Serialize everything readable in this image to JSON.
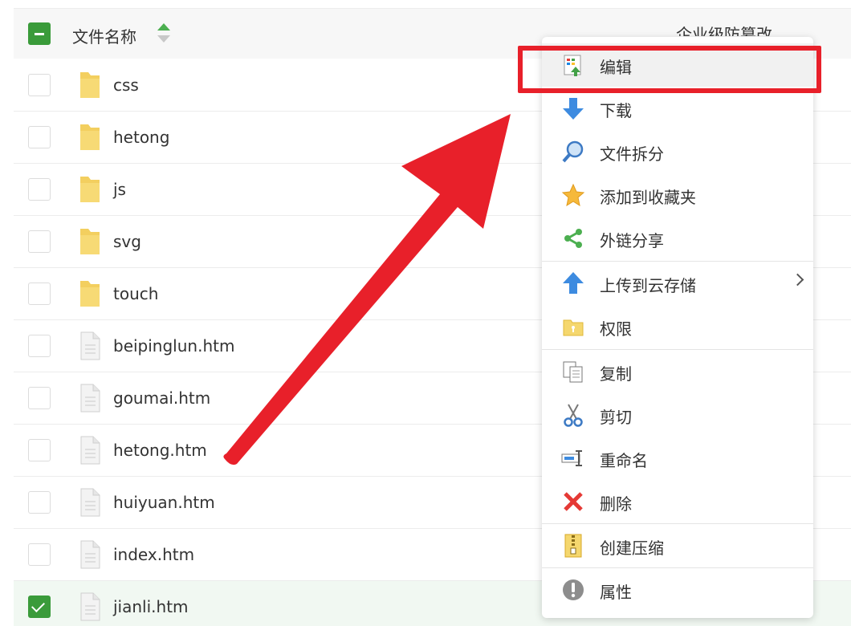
{
  "header": {
    "name_label": "文件名称",
    "col2_label": "企业级防篡改"
  },
  "files": [
    {
      "name": "css",
      "type": "folder",
      "checked": false
    },
    {
      "name": "hetong",
      "type": "folder",
      "checked": false
    },
    {
      "name": "js",
      "type": "folder",
      "checked": false
    },
    {
      "name": "svg",
      "type": "folder",
      "checked": false
    },
    {
      "name": "touch",
      "type": "folder",
      "checked": false
    },
    {
      "name": "beipinglun.htm",
      "type": "file",
      "checked": false
    },
    {
      "name": "goumai.htm",
      "type": "file",
      "checked": false
    },
    {
      "name": "hetong.htm",
      "type": "file",
      "checked": false
    },
    {
      "name": "huiyuan.htm",
      "type": "file",
      "checked": false
    },
    {
      "name": "index.htm",
      "type": "file",
      "checked": false
    },
    {
      "name": "jianli.htm",
      "type": "file",
      "checked": true
    }
  ],
  "menu": {
    "edit": "编辑",
    "download": "下载",
    "split": "文件拆分",
    "favorite": "添加到收藏夹",
    "share": "外链分享",
    "upload_cloud": "上传到云存储",
    "permission": "权限",
    "copy": "复制",
    "cut": "剪切",
    "rename": "重命名",
    "delete": "删除",
    "compress": "创建压缩",
    "properties": "属性"
  },
  "colors": {
    "accent_green": "#3a9b3a",
    "annotation_red": "#e8202a"
  }
}
